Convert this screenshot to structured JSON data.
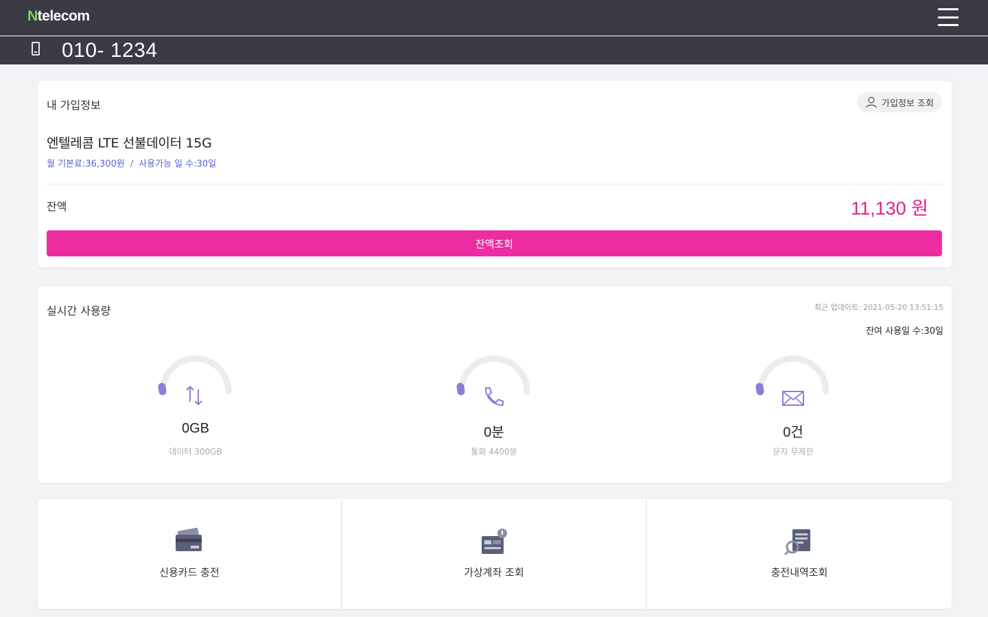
{
  "header": {
    "logo_mark": "N",
    "logo_text": "telecom",
    "menu_icon": "hamburger-menu-icon",
    "phone_icon": "mobile-phone-icon",
    "phone_number": "010- 1234"
  },
  "subscription": {
    "title": "내 가입정보",
    "lookup_button": "가입정보 조회",
    "lookup_icon": "person-icon",
    "plan_name": "엔텔레콤 LTE 선불데이터 15G",
    "monthly_fee": "월 기본료:36,300원",
    "separator": "/",
    "usable_days": "사용가능 일 수:30일",
    "balance_label": "잔액",
    "balance_amount": "11,130 원",
    "balance_button": "잔액조회"
  },
  "usage": {
    "title": "실시간 사용량",
    "updated_at": "최근 업데이트: 2021-05-20 13:51:15",
    "remaining_days": "잔여 사용일 수:30일",
    "gauges": [
      {
        "icon": "data-transfer-icon",
        "value": "0GB",
        "label": "데이터 300GB",
        "fraction": 0.0
      },
      {
        "icon": "phone-call-icon",
        "value": "0분",
        "label": "통화 4400분",
        "fraction": 0.0
      },
      {
        "icon": "envelope-icon",
        "value": "0건",
        "label": "문자 무제한",
        "fraction": 0.0
      }
    ]
  },
  "actions": [
    {
      "label": "신용카드 충전",
      "icon": "credit-card-icon"
    },
    {
      "label": "가상계좌 조회",
      "icon": "virtual-account-icon"
    },
    {
      "label": "충전내역조회",
      "icon": "charge-history-icon"
    }
  ],
  "colors": {
    "header_bg": "#3a3b44",
    "accent_pink": "#ee2ca2",
    "balance_pink": "#e61e8c",
    "gauge_purple": "#8f7cd6",
    "meta_blue": "#5a5fd0"
  }
}
